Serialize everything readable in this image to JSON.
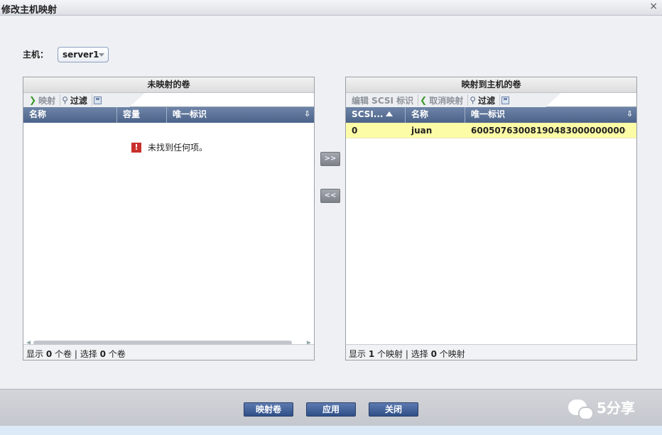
{
  "window": {
    "title": "修改主机映射",
    "close_icon": "×"
  },
  "host": {
    "label": "主机：",
    "selected": "server1"
  },
  "left_panel": {
    "title": "未映射的卷",
    "toolbar": {
      "map": "映射",
      "filter": "过滤"
    },
    "columns": [
      "名称",
      "容量",
      "唯一标识"
    ],
    "empty_message": "未找到任何项。",
    "footer": {
      "show_prefix": "显示",
      "show_count": "0",
      "show_unit": "个卷",
      "sep": "|",
      "select_prefix": "选择",
      "select_count": "0",
      "select_unit": "个卷"
    }
  },
  "right_panel": {
    "title": "映射到主机的卷",
    "toolbar": {
      "edit_scsi": "编辑 SCSI 标识",
      "unmap": "取消映射",
      "filter": "过滤"
    },
    "columns": [
      "SCSI...",
      "名称",
      "唯一标识"
    ],
    "rows": [
      {
        "scsi": "0",
        "name": "juan",
        "uid": "60050763008190483000000000000..."
      }
    ],
    "footer": {
      "show_prefix": "显示",
      "show_count": "1",
      "show_unit": "个映射",
      "sep": "|",
      "select_prefix": "选择",
      "select_count": "0",
      "select_unit": "个映射"
    }
  },
  "move": {
    "add": ">>",
    "remove": "<<"
  },
  "buttons": {
    "map_volumes": "映射卷",
    "apply": "应用",
    "close": "关闭"
  },
  "watermark": "5分享",
  "colors": {
    "header_blue": "#4c6389",
    "row_highlight": "#fdfca6",
    "button_blue": "#2f4f88"
  }
}
